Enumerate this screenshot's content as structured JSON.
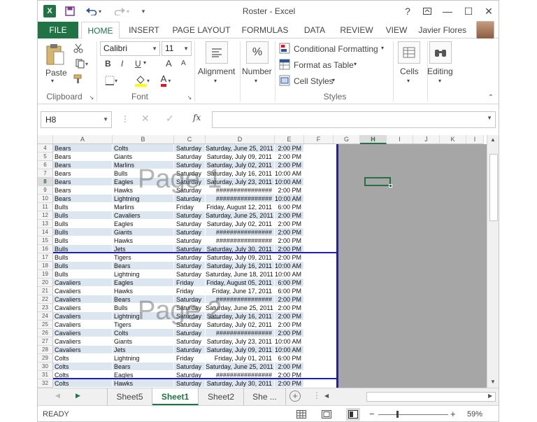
{
  "window": {
    "title": "Roster - Excel",
    "app_icon": "X",
    "help": "?",
    "ribbon_display_icon": "ribbon-display-icon",
    "minimize": "—",
    "maximize": "☐",
    "close": "✕"
  },
  "tabs": {
    "file": "FILE",
    "home": "HOME",
    "insert": "INSERT",
    "page_layout": "PAGE LAYOUT",
    "formulas": "FORMULAS",
    "data": "DATA",
    "review": "REVIEW",
    "view": "VIEW",
    "user": "Javier Flores"
  },
  "ribbon": {
    "clipboard": {
      "paste": "Paste",
      "label": "Clipboard"
    },
    "font": {
      "name": "Calibri",
      "size": "11",
      "label": "Font",
      "bold": "B",
      "italic": "I",
      "underline": "U",
      "grow": "A",
      "shrink": "A",
      "color_letter": "A"
    },
    "alignment": {
      "label": "Alignment"
    },
    "number": {
      "label": "Number",
      "symbol": "%"
    },
    "styles": {
      "conditional": "Conditional Formatting",
      "format_table": "Format as Table",
      "cell_styles": "Cell Styles",
      "label": "Styles"
    },
    "cells": {
      "label": "Cells"
    },
    "editing": {
      "label": "Editing"
    }
  },
  "formula_bar": {
    "name_box": "H8",
    "fx": "fx",
    "value": ""
  },
  "columns": [
    "A",
    "B",
    "C",
    "D",
    "E",
    "F",
    "G",
    "H",
    "I",
    "J",
    "K",
    "I"
  ],
  "selected_col": "H",
  "selected_row": "8",
  "watermarks": {
    "page1": "Page 1",
    "page2": "Page 2"
  },
  "rows": [
    {
      "n": "4",
      "a": "Bears",
      "b": "Colts",
      "c": "Saturday",
      "d": "Saturday, June 25, 2011",
      "e": "2:00 PM"
    },
    {
      "n": "5",
      "a": "Bears",
      "b": "Giants",
      "c": "Saturday",
      "d": "Saturday, July 09, 2011",
      "e": "2:00 PM"
    },
    {
      "n": "6",
      "a": "Bears",
      "b": "Marlins",
      "c": "Saturday",
      "d": "Saturday, July 02, 2011",
      "e": "2:00 PM"
    },
    {
      "n": "7",
      "a": "Bears",
      "b": "Bulls",
      "c": "Saturday",
      "d": "Saturday, July 16, 2011",
      "e": "10:00 AM"
    },
    {
      "n": "8",
      "a": "Bears",
      "b": "Eagles",
      "c": "Saturday",
      "d": "Saturday, July 23, 2011",
      "e": "10:00 AM"
    },
    {
      "n": "9",
      "a": "Bears",
      "b": "Hawks",
      "c": "Saturday",
      "d": "################",
      "e": "2:00 PM"
    },
    {
      "n": "10",
      "a": "Bears",
      "b": "Lightning",
      "c": "Saturday",
      "d": "################",
      "e": "10:00 AM"
    },
    {
      "n": "11",
      "a": "Bulls",
      "b": "Marlins",
      "c": "Friday",
      "d": "Friday, August 12, 2011",
      "e": "6:00 PM"
    },
    {
      "n": "12",
      "a": "Bulls",
      "b": "Cavaliers",
      "c": "Saturday",
      "d": "Saturday, June 25, 2011",
      "e": "2:00 PM"
    },
    {
      "n": "13",
      "a": "Bulls",
      "b": "Eagles",
      "c": "Saturday",
      "d": "Saturday, July 02, 2011",
      "e": "2:00 PM"
    },
    {
      "n": "14",
      "a": "Bulls",
      "b": "Giants",
      "c": "Saturday",
      "d": "################",
      "e": "2:00 PM"
    },
    {
      "n": "15",
      "a": "Bulls",
      "b": "Hawks",
      "c": "Saturday",
      "d": "################",
      "e": "2:00 PM"
    },
    {
      "n": "16",
      "a": "Bulls",
      "b": "Jets",
      "c": "Saturday",
      "d": "Saturday, July 30, 2011",
      "e": "2:00 PM"
    },
    {
      "n": "17",
      "a": "Bulls",
      "b": "Tigers",
      "c": "Saturday",
      "d": "Saturday, July 09, 2011",
      "e": "2:00 PM"
    },
    {
      "n": "18",
      "a": "Bulls",
      "b": "Bears",
      "c": "Saturday",
      "d": "Saturday, July 16, 2011",
      "e": "10:00 AM"
    },
    {
      "n": "19",
      "a": "Bulls",
      "b": "Lightning",
      "c": "Saturday",
      "d": "Saturday, June 18, 2011",
      "e": "10:00 AM"
    },
    {
      "n": "20",
      "a": "Cavaliers",
      "b": "Eagles",
      "c": "Friday",
      "d": "Friday, August 05, 2011",
      "e": "6:00 PM"
    },
    {
      "n": "21",
      "a": "Cavaliers",
      "b": "Hawks",
      "c": "Friday",
      "d": "Friday, June 17, 2011",
      "e": "6:00 PM"
    },
    {
      "n": "22",
      "a": "Cavaliers",
      "b": "Bears",
      "c": "Saturday",
      "d": "################",
      "e": "2:00 PM"
    },
    {
      "n": "23",
      "a": "Cavaliers",
      "b": "Bulls",
      "c": "Saturday",
      "d": "Saturday, June 25, 2011",
      "e": "2:00 PM"
    },
    {
      "n": "24",
      "a": "Cavaliers",
      "b": "Lightning",
      "c": "Saturday",
      "d": "Saturday, July 16, 2011",
      "e": "2:00 PM"
    },
    {
      "n": "25",
      "a": "Cavaliers",
      "b": "Tigers",
      "c": "Saturday",
      "d": "Saturday, July 02, 2011",
      "e": "2:00 PM"
    },
    {
      "n": "26",
      "a": "Cavaliers",
      "b": "Colts",
      "c": "Saturday",
      "d": "################",
      "e": "2:00 PM"
    },
    {
      "n": "27",
      "a": "Cavaliers",
      "b": "Giants",
      "c": "Saturday",
      "d": "Saturday, July 23, 2011",
      "e": "10:00 AM"
    },
    {
      "n": "28",
      "a": "Cavaliers",
      "b": "Jets",
      "c": "Saturday",
      "d": "Saturday, July 09, 2011",
      "e": "10:00 AM"
    },
    {
      "n": "29",
      "a": "Colts",
      "b": "Lightning",
      "c": "Friday",
      "d": "Friday, July 01, 2011",
      "e": "6:00 PM"
    },
    {
      "n": "30",
      "a": "Colts",
      "b": "Bears",
      "c": "Saturday",
      "d": "Saturday, June 25, 2011",
      "e": "2:00 PM"
    },
    {
      "n": "31",
      "a": "Colts",
      "b": "Eagles",
      "c": "Saturday",
      "d": "################",
      "e": "2:00 PM"
    },
    {
      "n": "32",
      "a": "Colts",
      "b": "Hawks",
      "c": "Saturday",
      "d": "Saturday, July 30, 2011",
      "e": "2:00 PM"
    }
  ],
  "sheets": {
    "s5": "Sheet5",
    "s1": "Sheet1",
    "s2": "Sheet2",
    "more": "She ...",
    "add": "+"
  },
  "status": {
    "ready": "READY",
    "zoom": "59%",
    "minus": "−",
    "plus": "+"
  }
}
